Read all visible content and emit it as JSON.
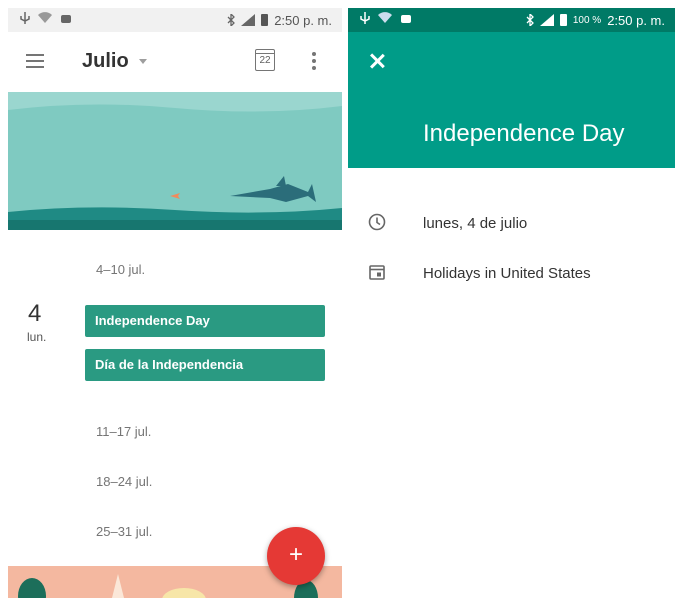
{
  "left": {
    "status": {
      "time": "2:50 p. m."
    },
    "appbar": {
      "month": "Julio",
      "calendar_day": "22"
    },
    "agenda": {
      "weeks": [
        {
          "label": "4–10 jul."
        },
        {
          "label": "11–17 jul."
        },
        {
          "label": "18–24 jul."
        },
        {
          "label": "25–31 jul."
        }
      ],
      "day": {
        "number": "4",
        "weekday": "lun."
      },
      "events": [
        {
          "title": "Independence Day"
        },
        {
          "title": "Día de la Independencia"
        }
      ]
    },
    "fab": {
      "label": "+"
    }
  },
  "right": {
    "status": {
      "battery": "100 %",
      "time": "2:50 p. m."
    },
    "detail": {
      "title": "Independence Day",
      "date": "lunes, 4 de julio",
      "calendar": "Holidays in United States"
    }
  },
  "colors": {
    "event": "#2a9a82",
    "header": "#009c88",
    "fab": "#e53935"
  },
  "icons": [
    "menu-icon",
    "dropdown-caret-icon",
    "calendar-today-icon",
    "more-vert-icon",
    "add-icon",
    "close-icon",
    "clock-icon",
    "calendar-icon",
    "usb-icon",
    "wifi-icon",
    "android-icon",
    "bluetooth-icon",
    "signal-icon",
    "battery-icon"
  ]
}
